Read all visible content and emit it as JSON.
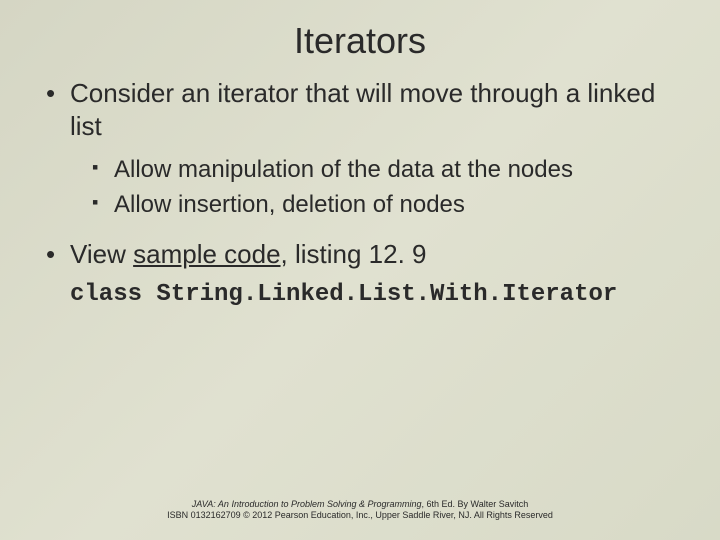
{
  "title": "Iterators",
  "bullets": {
    "b1": "Consider an iterator that will move through a linked list",
    "b1_sub1": "Allow manipulation of the data at the nodes",
    "b1_sub2": "Allow insertion, deletion of nodes",
    "b2_pre": "View ",
    "b2_link": "sample code",
    "b2_post": ", listing 12. 9"
  },
  "code_line": "class String.Linked.List.With.Iterator",
  "footer": {
    "line1_italic": "JAVA: An Introduction to Problem Solving & Programming",
    "line1_rest": ", 6th Ed. By Walter Savitch",
    "line2": "ISBN 0132162709 © 2012 Pearson Education, Inc., Upper Saddle River, NJ. All Rights Reserved"
  }
}
